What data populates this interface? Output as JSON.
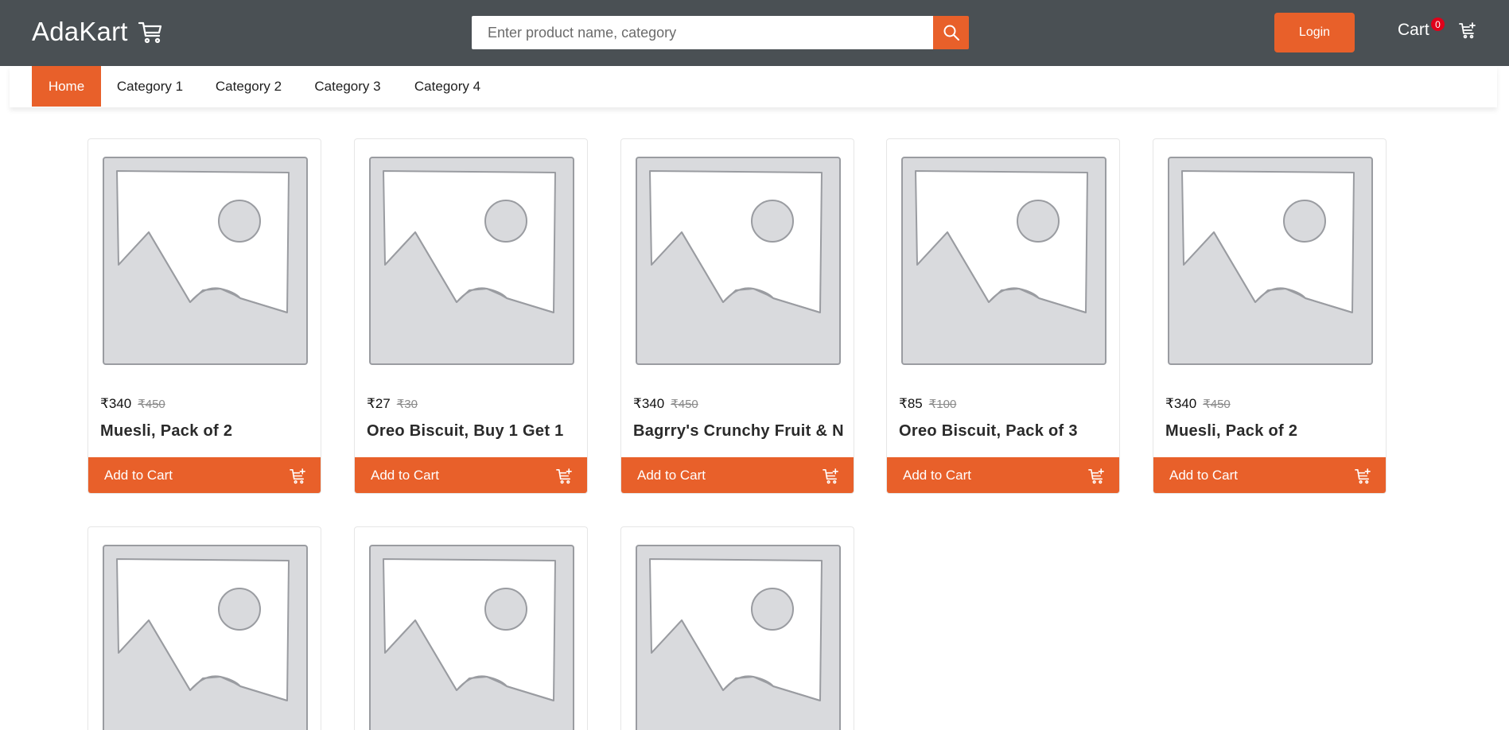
{
  "header": {
    "brand": "AdaKart",
    "search_placeholder": "Enter product name, category",
    "login_label": "Login",
    "cart_label": "Cart",
    "cart_count": "0"
  },
  "nav": {
    "items": [
      "Home",
      "Category 1",
      "Category 2",
      "Category 3",
      "Category 4"
    ],
    "active": "Home"
  },
  "products": [
    {
      "price": "₹340",
      "old_price": "₹450",
      "name": "Muesli, Pack of 2",
      "button": "Add to Cart"
    },
    {
      "price": "₹27",
      "old_price": "₹30",
      "name": "Oreo Biscuit, Buy 1 Get 1",
      "button": "Add to Cart"
    },
    {
      "price": "₹340",
      "old_price": "₹450",
      "name": "Bagrry's Crunchy Fruit & N",
      "button": "Add to Cart"
    },
    {
      "price": "₹85",
      "old_price": "₹100",
      "name": "Oreo Biscuit, Pack of 3",
      "button": "Add to Cart"
    },
    {
      "price": "₹340",
      "old_price": "₹450",
      "name": "Muesli, Pack of 2",
      "button": "Add to Cart"
    }
  ],
  "colors": {
    "header_bg": "#4a5054",
    "accent": "#e8602a",
    "badge": "#e0001a"
  },
  "icons": {
    "brand": "shopping-cart-icon",
    "search": "search-icon",
    "cart": "cart-plus-icon",
    "product_image": "image-placeholder-icon"
  }
}
